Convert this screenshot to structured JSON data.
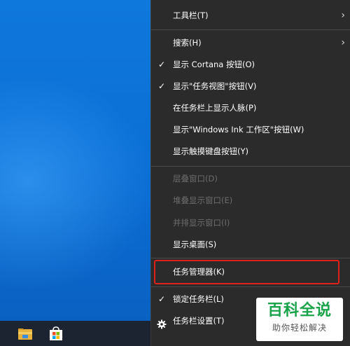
{
  "context_menu": {
    "items": [
      {
        "label": "工具栏(T)",
        "checked": false,
        "submenu": true,
        "disabled": false
      },
      {
        "label": "搜索(H)",
        "checked": false,
        "submenu": true,
        "disabled": false
      },
      {
        "label": "显示 Cortana 按钮(O)",
        "checked": true,
        "submenu": false,
        "disabled": false
      },
      {
        "label": "显示\"任务视图\"按钮(V)",
        "checked": true,
        "submenu": false,
        "disabled": false
      },
      {
        "label": "在任务栏上显示人脉(P)",
        "checked": false,
        "submenu": false,
        "disabled": false
      },
      {
        "label": "显示\"Windows Ink 工作区\"按钮(W)",
        "checked": false,
        "submenu": false,
        "disabled": false
      },
      {
        "label": "显示触摸键盘按钮(Y)",
        "checked": false,
        "submenu": false,
        "disabled": false
      },
      {
        "label": "层叠窗口(D)",
        "checked": false,
        "submenu": false,
        "disabled": true
      },
      {
        "label": "堆叠显示窗口(E)",
        "checked": false,
        "submenu": false,
        "disabled": true
      },
      {
        "label": "并排显示窗口(I)",
        "checked": false,
        "submenu": false,
        "disabled": true
      },
      {
        "label": "显示桌面(S)",
        "checked": false,
        "submenu": false,
        "disabled": false
      },
      {
        "label": "任务管理器(K)",
        "checked": false,
        "submenu": false,
        "disabled": false,
        "highlighted": true
      },
      {
        "label": "锁定任务栏(L)",
        "checked": true,
        "submenu": false,
        "disabled": false
      },
      {
        "label": "任务栏设置(T)",
        "checked": false,
        "submenu": false,
        "disabled": false,
        "icon": "gear-icon"
      }
    ]
  },
  "taskbar": {
    "icons": [
      "file-explorer-icon",
      "microsoft-store-icon"
    ]
  },
  "watermark": {
    "title": "百科全说",
    "subtitle": "助你轻松解决"
  },
  "colors": {
    "menu_bg": "#2b2b2b",
    "desktop_blue": "#0b6fd6",
    "taskbar_bg": "#1b2430",
    "highlight_border": "#e0201a",
    "watermark_green": "#1aa34a"
  }
}
